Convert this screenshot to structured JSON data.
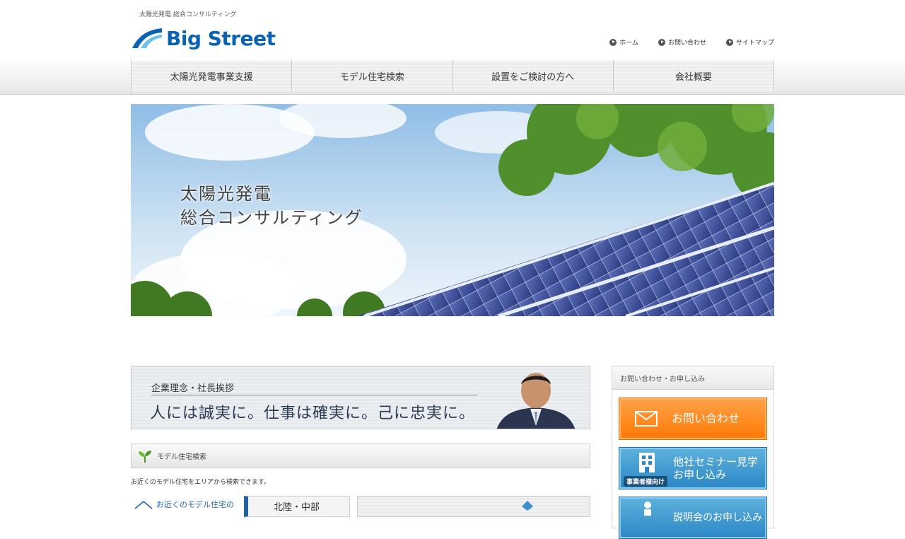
{
  "header": {
    "tagline": "太陽光発電 総合コンサルティング",
    "logo_text": "Big Street"
  },
  "utility_links": [
    "ホーム",
    "お問い合わせ",
    "サイトマップ"
  ],
  "global_nav": [
    "太陽光発電事業支援",
    "モデル住宅検索",
    "設置をご検討の方へ",
    "会社概要"
  ],
  "hero": {
    "line1": "太陽光発電",
    "line2": "総合コンサルティング"
  },
  "banner": {
    "subtitle": "企業理念・社長挨拶",
    "message": "人には誠実に。仕事は確実に。己に忠実に。"
  },
  "section": {
    "title": "モデル住宅検索",
    "description": "お近くのモデル住宅をエリアから検索できます。"
  },
  "thumbs": {
    "t1": "お近くのモデル住宅の",
    "t2": "北陸・中部"
  },
  "sidebar": {
    "title": "お問い合わせ・お申し込み",
    "contact_label": "お問い合わせ",
    "seminar_line1": "他社セミナー見学",
    "seminar_line2": "お申し込み",
    "seminar_badge": "事業者様向け",
    "briefing_label": "説明会のお申し込み"
  },
  "colors": {
    "brand_blue": "#0a63b0",
    "contact_orange": "#ff7a05",
    "seminar_blue": "#2a86c4"
  }
}
